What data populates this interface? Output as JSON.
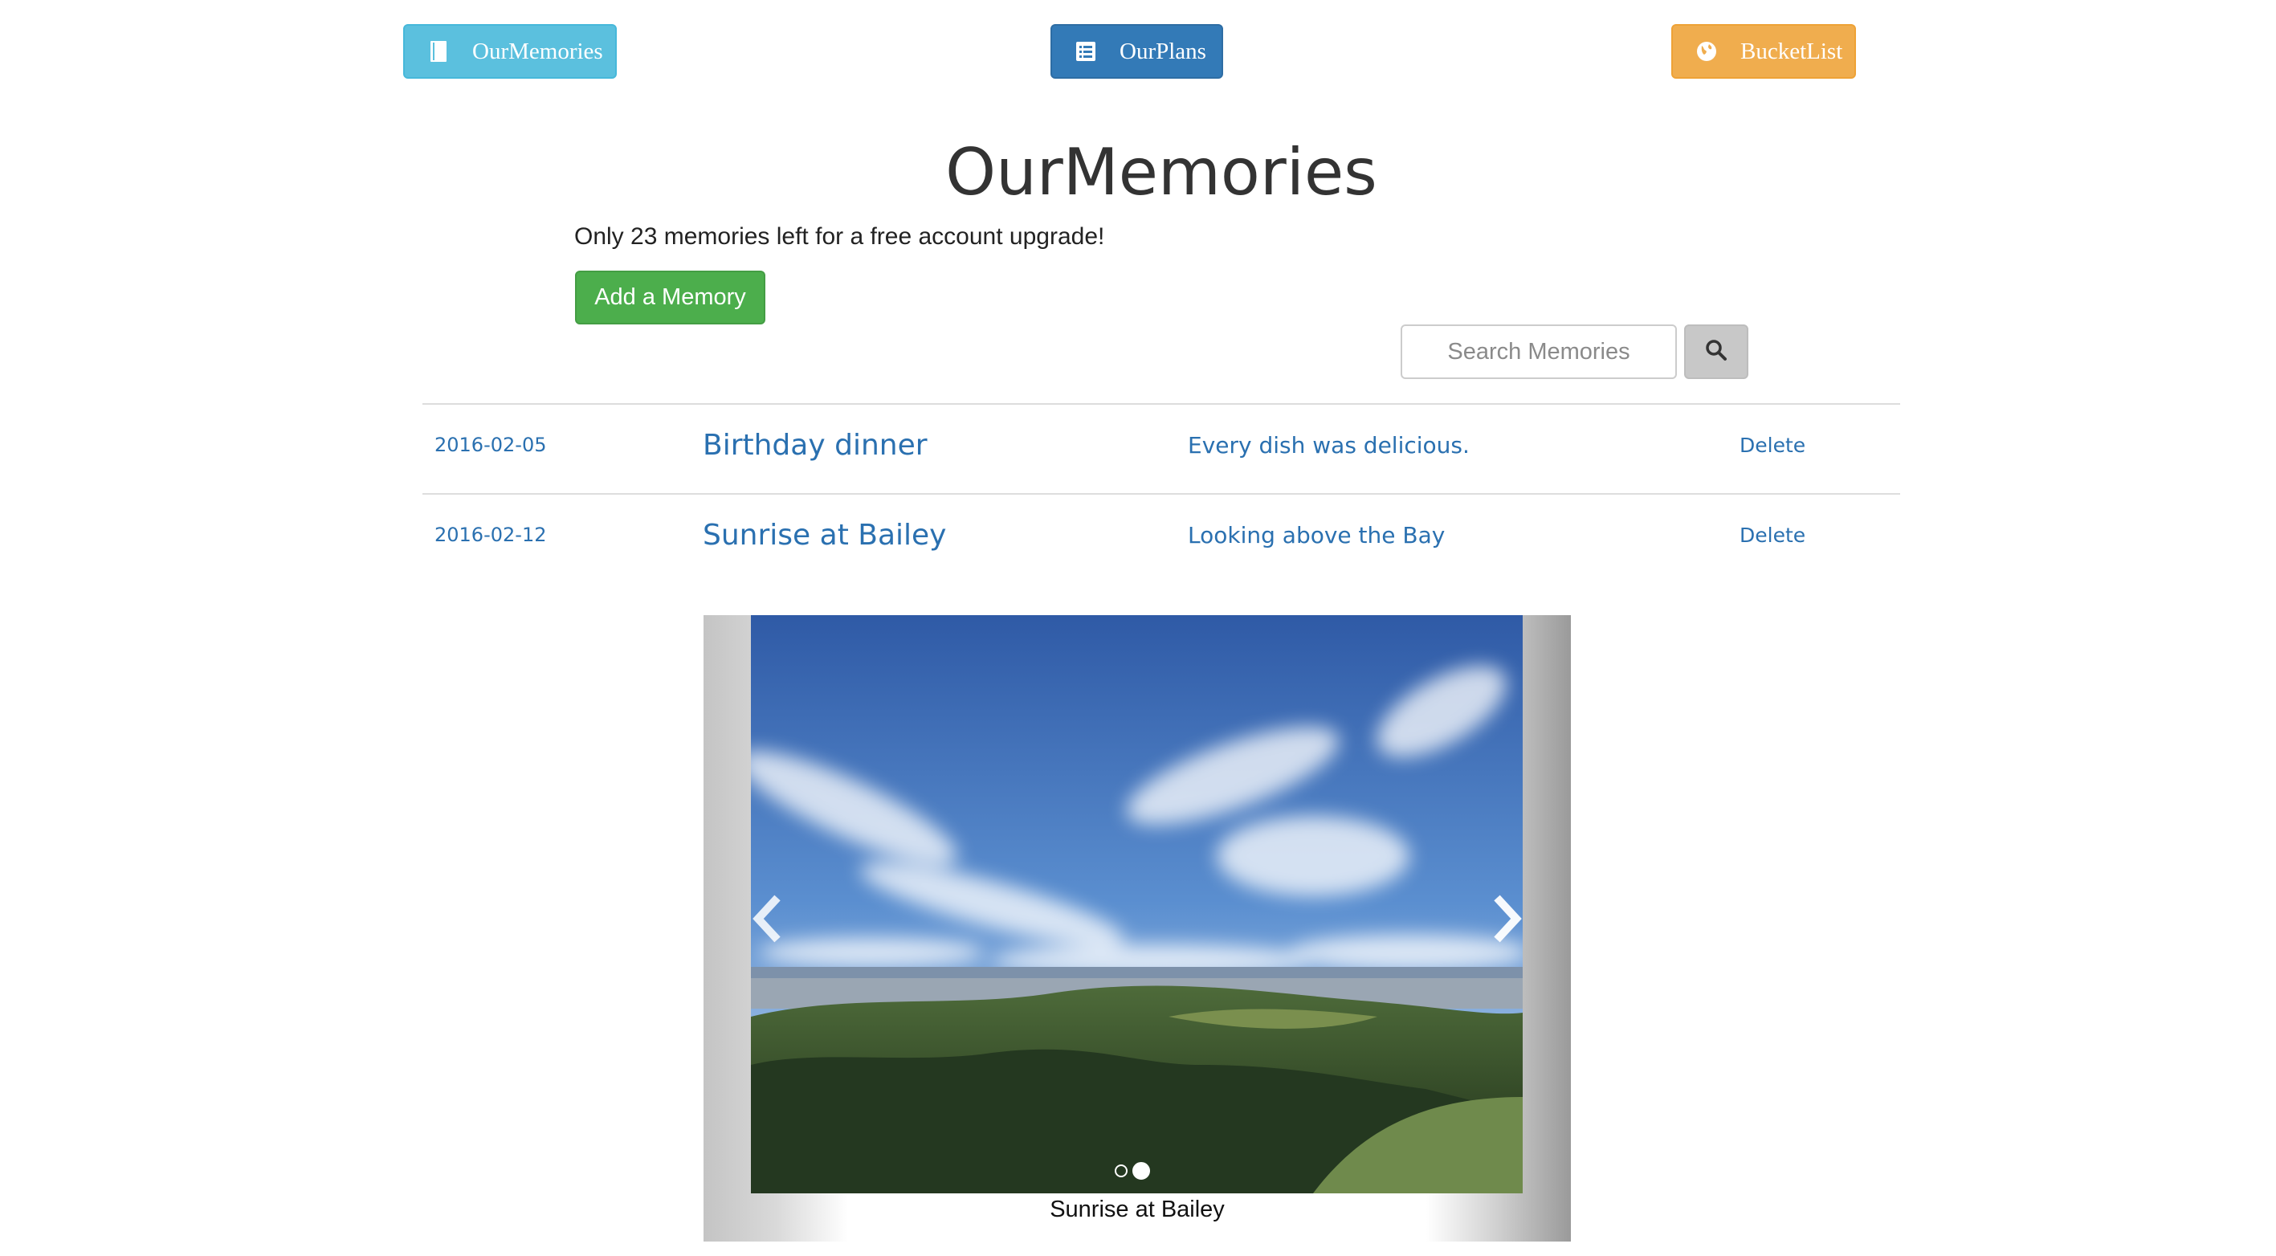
{
  "nav": {
    "memories_label": "OurMemories",
    "plans_label": "OurPlans",
    "bucket_label": "BucketList",
    "memories_icon": "book-icon",
    "plans_icon": "list-alt-icon",
    "bucket_icon": "globe-icon",
    "colors": {
      "memories": "#5bc0de",
      "plans": "#337ab7",
      "bucket": "#f0ad4e"
    }
  },
  "main": {
    "title": "OurMemories",
    "upgrade_note": "Only 23 memories left for a free account upgrade!",
    "add_button_label": "Add a Memory",
    "add_button_color": "#4cae4c"
  },
  "search": {
    "placeholder": "Search Memories",
    "button_icon": "search-icon"
  },
  "memories": [
    {
      "date": "2016-02-05",
      "title": "Birthday dinner",
      "description": "Every dish was delicious.",
      "delete_label": "Delete"
    },
    {
      "date": "2016-02-12",
      "title": "Sunrise at Bailey",
      "description": "Looking above the Bay",
      "delete_label": "Delete"
    }
  ],
  "carousel": {
    "caption": "Sunrise at Bailey",
    "slide_count": 2,
    "active_index": 1,
    "prev_icon": "chevron-left-icon",
    "next_icon": "chevron-right-icon"
  }
}
